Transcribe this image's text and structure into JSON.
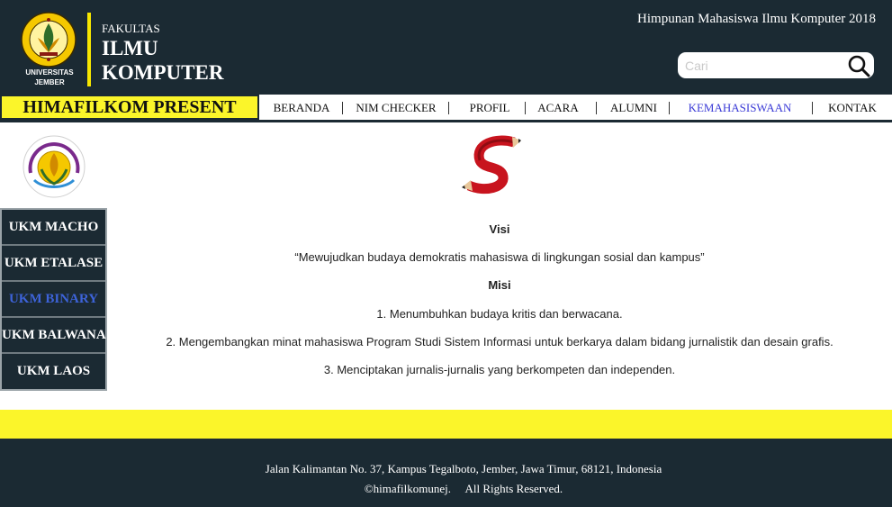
{
  "header": {
    "univ_line1": "UNIVERSITAS",
    "univ_line2": "JEMBER",
    "faculty_small": "FAKULTAS",
    "faculty_line1": "ILMU",
    "faculty_line2": "KOMPUTER",
    "hima_title": "Himpunan Mahasiswa Ilmu Komputer 2018",
    "search_placeholder": "Cari",
    "search_value": ""
  },
  "nav": {
    "brand": "HIMAFILKOM PRESENT",
    "items": [
      {
        "label": "BERANDA"
      },
      {
        "label": "NIM CHECKER"
      },
      {
        "label": "PROFIL"
      },
      {
        "label": "ACARA"
      },
      {
        "label": "ALUMNI"
      },
      {
        "label": "KEMAHASISWAAN",
        "active": true
      },
      {
        "label": "KONTAK"
      }
    ]
  },
  "sidebar": {
    "items": [
      {
        "label": "UKM MACHO"
      },
      {
        "label": "UKM ETALASE"
      },
      {
        "label": "UKM BINARY",
        "active": true
      },
      {
        "label": "UKM BALWANA"
      },
      {
        "label": "UKM LAOS"
      }
    ]
  },
  "content": {
    "visi_heading": "Visi",
    "visi_text": "“Mewujudkan budaya demokratis mahasiswa di lingkungan sosial dan kampus”",
    "misi_heading": "Misi",
    "misi_items": [
      "1. Menumbuhkan budaya kritis dan berwacana.",
      "2. Mengembangkan minat mahasiswa Program Studi Sistem Informasi untuk berkarya dalam bidang jurnalistik dan desain grafis.",
      "3. Menciptakan jurnalis-jurnalis yang berkompeten dan independen."
    ]
  },
  "footer": {
    "address": "Jalan Kalimantan No. 37, Kampus Tegalboto, Jember, Jawa Timur, 68121, Indonesia",
    "copyright": "©himafilkomunej.     All Rights Reserved."
  },
  "colors": {
    "header_bg": "#1b2a33",
    "accent_yellow": "#fbf52a",
    "active_link": "#3b3bd6",
    "sidebar_active": "#3d63d9",
    "logo_red": "#c8141e"
  }
}
